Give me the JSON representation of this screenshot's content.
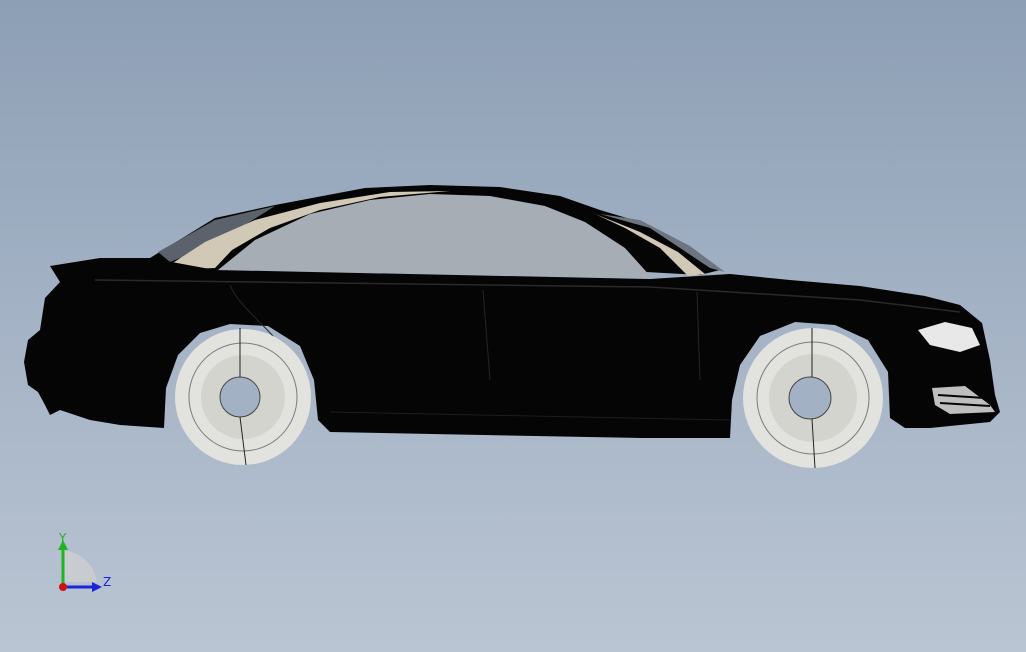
{
  "viewport": {
    "background_top": "#8d9fb5",
    "background_bottom": "#bac5d3"
  },
  "model": {
    "body_color": "#050505",
    "pillar_color": "#d2c8b6",
    "glass_color": "#a7adb4",
    "wheel_color": "#dcdcd8",
    "view": "side"
  },
  "triad": {
    "y_label": "Y",
    "z_label": "Z",
    "y_color": "#1fb51f",
    "z_color": "#1a25d8",
    "x_color": "#d01010"
  }
}
